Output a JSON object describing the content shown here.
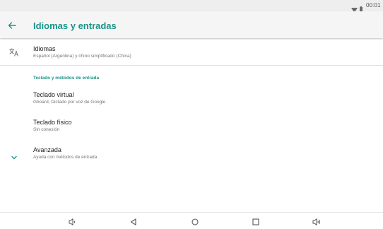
{
  "status_bar": {
    "time": "00:01",
    "icons": [
      "wifi-icon",
      "battery-icon"
    ]
  },
  "app_bar": {
    "title": "Idiomas y entradas",
    "back_icon": "arrow-back-icon"
  },
  "accent_color": "#1a9488",
  "languages": {
    "icon": "translate-icon",
    "title": "Idiomas",
    "subtitle": "Español (Argentina) y chino simplificado (China)"
  },
  "keyboard_section": {
    "header": "Teclado y métodos de entrada",
    "items": [
      {
        "title": "Teclado virtual",
        "subtitle": "Gboard, Dictado por voz de Google"
      },
      {
        "title": "Teclado físico",
        "subtitle": "Sin conexión"
      }
    ]
  },
  "advanced": {
    "icon": "chevron-down-icon",
    "title": "Avanzada",
    "subtitle": "Ayuda con métodos de entrada"
  },
  "nav_bar": {
    "icons": [
      "volume-down-icon",
      "back-triangle-icon",
      "home-circle-icon",
      "recents-square-icon",
      "volume-up-icon"
    ]
  }
}
